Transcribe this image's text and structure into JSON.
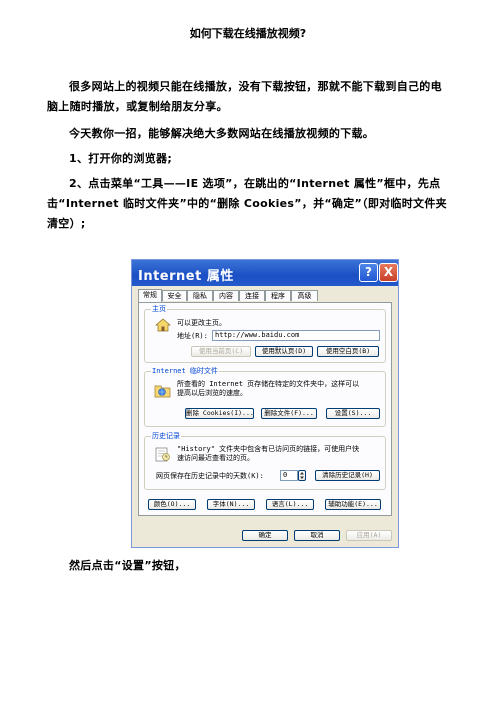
{
  "doc": {
    "title": "如何下载在线播放视频?",
    "para1": "很多网站上的视频只能在线播放，没有下载按钮，那就不能下载到自己的电脑上随时播放，或复制给朋友分享。",
    "para2": "今天教你一招，能够解决绝大多数网站在线播放视频的下载。",
    "step1": "1、打开你的浏览器;",
    "step2": "2、点击菜单“工具——IE 选项”，在跳出的“Internet 属性”框中，先点击“Internet 临时文件夹”中的“删除 Cookies”，并“确定”（即对临时文件夹清空）;",
    "footer": "然后点击“设置”按钮，"
  },
  "dialog": {
    "title": "Internet 属性",
    "help_label": "?",
    "close_label": "X",
    "tabs": [
      "常规",
      "安全",
      "隐私",
      "内容",
      "连接",
      "程序",
      "高级"
    ],
    "homepage": {
      "label": "主页",
      "desc": "可以更改主页。",
      "address_label": "地址(R):",
      "address_value": "http://www.baidu.com",
      "use_current": "使用当前页(C)",
      "use_default": "使用默认页(D)",
      "use_blank": "使用空白页(B)"
    },
    "temp_files": {
      "label": "Internet 临时文件",
      "desc1": "所查看的 Internet 页存储在特定的文件夹中，这样可以",
      "desc2": "提高以后浏览的速度。",
      "delete_cookies": "删除 Cookies(I)...",
      "delete_files": "删除文件(F)...",
      "settings": "设置(S)..."
    },
    "history": {
      "label": "历史记录",
      "desc1": "\"History\" 文件夹中包含有已访问页的链接，可使用户快",
      "desc2": "速访问最近查看过的页。",
      "days_label": "网页保存在历史记录中的天数(K):",
      "days_value": "0",
      "clear_history": "清除历史记录(H)"
    },
    "bottom_buttons": {
      "colors": "颜色(O)...",
      "fonts": "字体(N)...",
      "languages": "语言(L)...",
      "accessibility": "辅助功能(E)..."
    },
    "ok": "确定",
    "cancel": "取消",
    "apply": "应用(A)"
  }
}
